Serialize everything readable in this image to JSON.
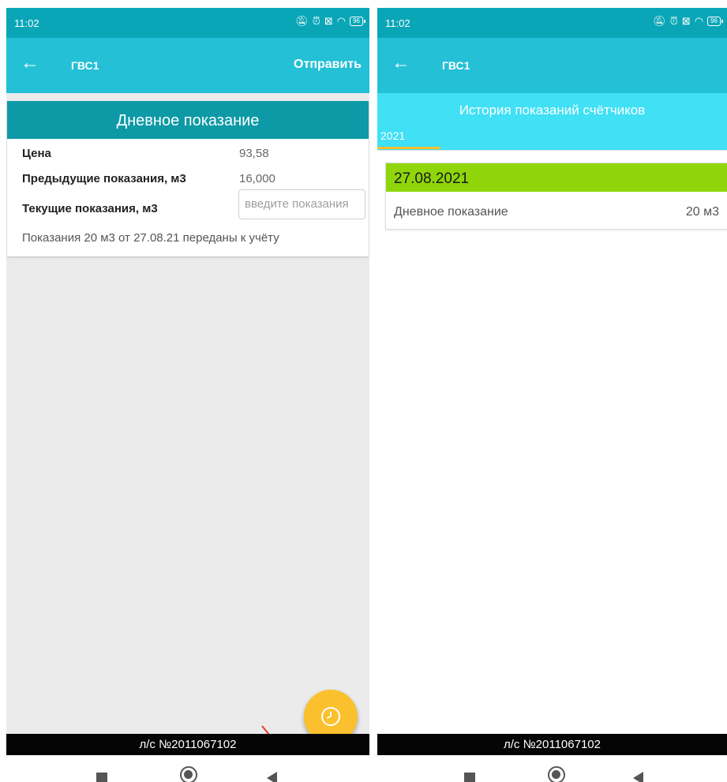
{
  "left_screen": {
    "status": {
      "time": "11:02",
      "battery": "96"
    },
    "toolbar": {
      "back_icon": "←",
      "title": "ГВС1",
      "action_label": "Отправить"
    },
    "card": {
      "header": "Дневное показание",
      "price_label": "Цена",
      "price_value": "93,58",
      "prev_label": "Предыдущие показания, м3",
      "prev_value": "16,000",
      "current_label": "Текущие показания, м3",
      "current_placeholder": "введите показания",
      "note": "Показания 20 м3 от 27.08.21 переданы к учёту"
    },
    "fab": {
      "icon": "clock-icon"
    },
    "account": "л/с №2011067102"
  },
  "right_screen": {
    "status": {
      "time": "11:02",
      "battery": "96"
    },
    "toolbar": {
      "back_icon": "←",
      "title": "ГВС1"
    },
    "history": {
      "title": "История показаний счётчиков",
      "tab": "2021",
      "entries": [
        {
          "date": "27.08.2021",
          "label": "Дневное показание",
          "value": "20 м3"
        }
      ]
    },
    "account": "л/с №2011067102"
  },
  "colors": {
    "status_bar": "#0aa6b8",
    "toolbar": "#23c0d6",
    "card_header": "#0d9aa6",
    "history_header": "#40e0f5",
    "date_bar": "#8fd50a",
    "fab": "#fbc02d",
    "annotation_arrow": "#e53935"
  }
}
